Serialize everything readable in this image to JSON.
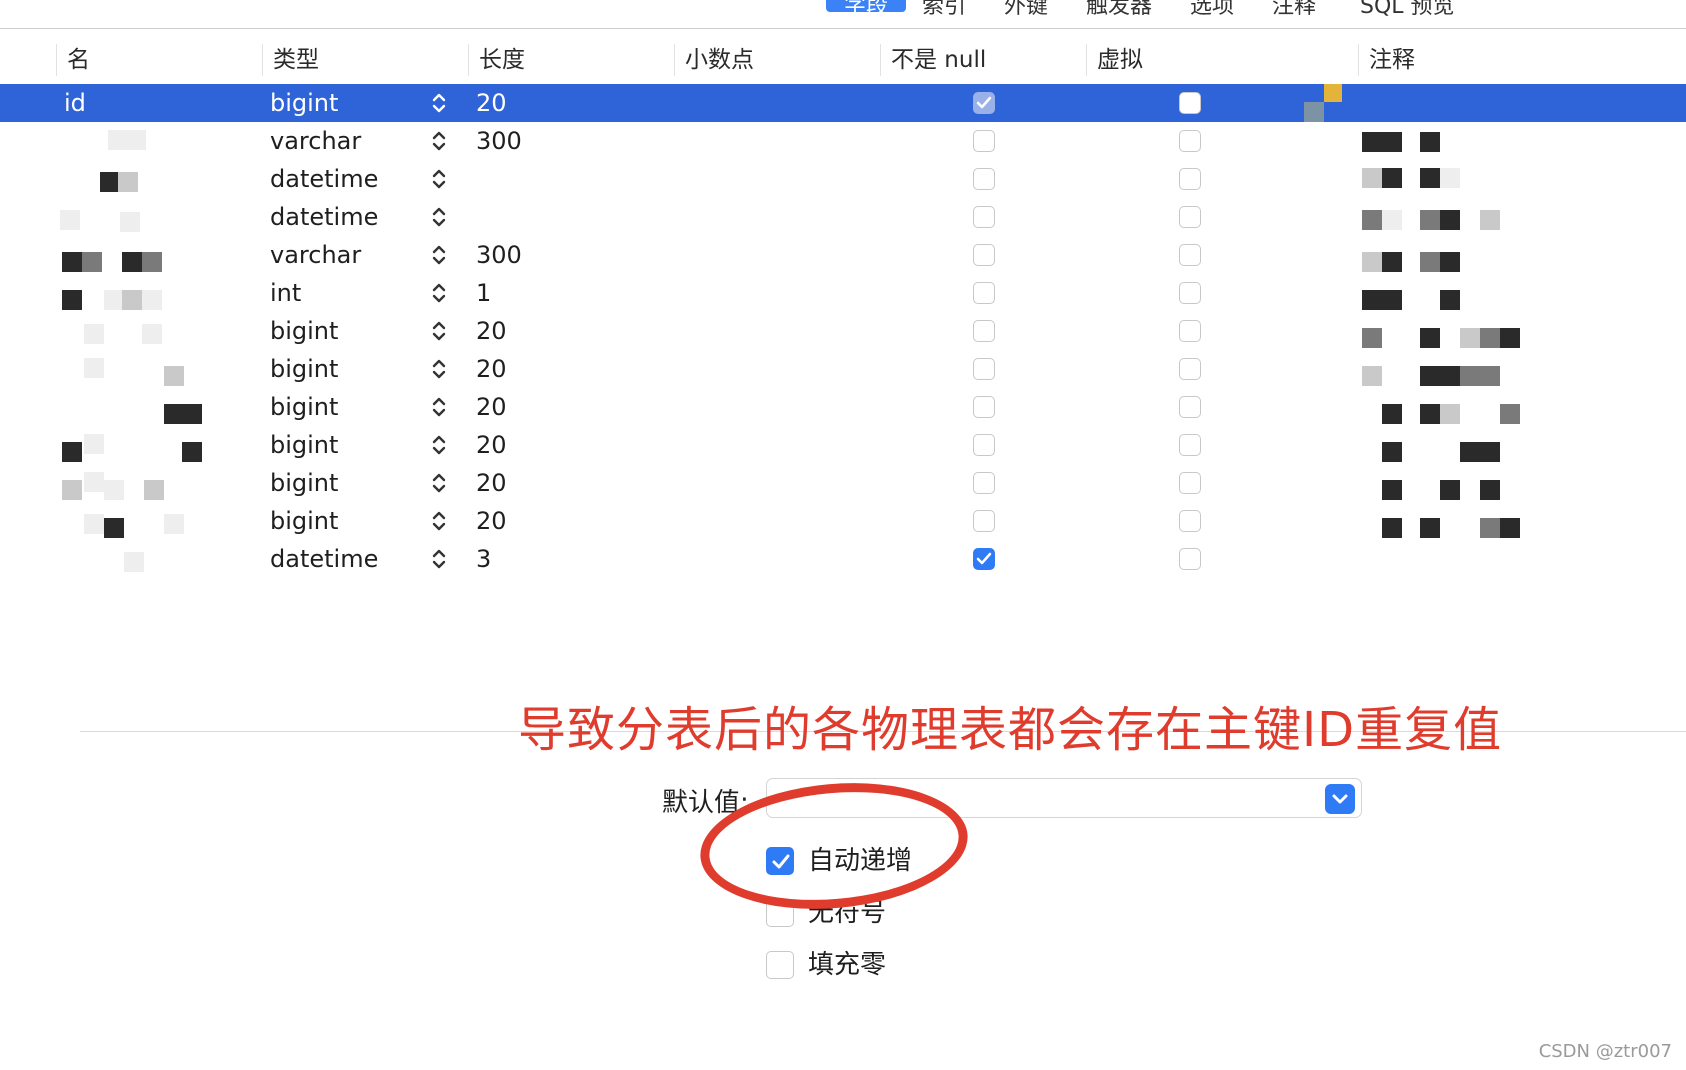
{
  "toolbar": {
    "tabs": [
      "字段",
      "索引",
      "外键",
      "触发器",
      "选项",
      "注释",
      "SQL 预览"
    ],
    "active_index": 0
  },
  "table": {
    "columns": [
      "名",
      "类型",
      "长度",
      "小数点",
      "不是 null",
      "虚拟",
      "注释"
    ],
    "rows": [
      {
        "name": "id",
        "type": "bigint",
        "length": "20",
        "not_null": true,
        "virtual": false,
        "selected": true
      },
      {
        "name": "",
        "type": "varchar",
        "length": "300",
        "not_null": false,
        "virtual": false
      },
      {
        "name": "",
        "type": "datetime",
        "length": "",
        "not_null": false,
        "virtual": false
      },
      {
        "name": "",
        "type": "datetime",
        "length": "",
        "not_null": false,
        "virtual": false
      },
      {
        "name": "",
        "type": "varchar",
        "length": "300",
        "not_null": false,
        "virtual": false
      },
      {
        "name": "",
        "type": "int",
        "length": "1",
        "not_null": false,
        "virtual": false
      },
      {
        "name": "",
        "type": "bigint",
        "length": "20",
        "not_null": false,
        "virtual": false
      },
      {
        "name": "",
        "type": "bigint",
        "length": "20",
        "not_null": false,
        "virtual": false
      },
      {
        "name": "",
        "type": "bigint",
        "length": "20",
        "not_null": false,
        "virtual": false
      },
      {
        "name": "",
        "type": "bigint",
        "length": "20",
        "not_null": false,
        "virtual": false
      },
      {
        "name": "",
        "type": "bigint",
        "length": "20",
        "not_null": false,
        "virtual": false
      },
      {
        "name": "",
        "type": "bigint",
        "length": "20",
        "not_null": false,
        "virtual": false
      },
      {
        "name": "",
        "type": "datetime",
        "length": "3",
        "not_null": true,
        "virtual": false
      }
    ]
  },
  "annotation": {
    "text": "导致分表后的各物理表都会存在主键ID重复值",
    "color": "#e03c2e"
  },
  "properties": {
    "default_label": "默认值:",
    "default_value": "",
    "options": [
      {
        "label": "自动递增",
        "checked": true
      },
      {
        "label": "无符号",
        "checked": false
      },
      {
        "label": "填充零",
        "checked": false
      }
    ]
  },
  "watermark": "CSDN @ztr007",
  "colors": {
    "selection": "#2f63d8",
    "accent": "#2f7bf6",
    "annotation": "#e03c2e"
  }
}
